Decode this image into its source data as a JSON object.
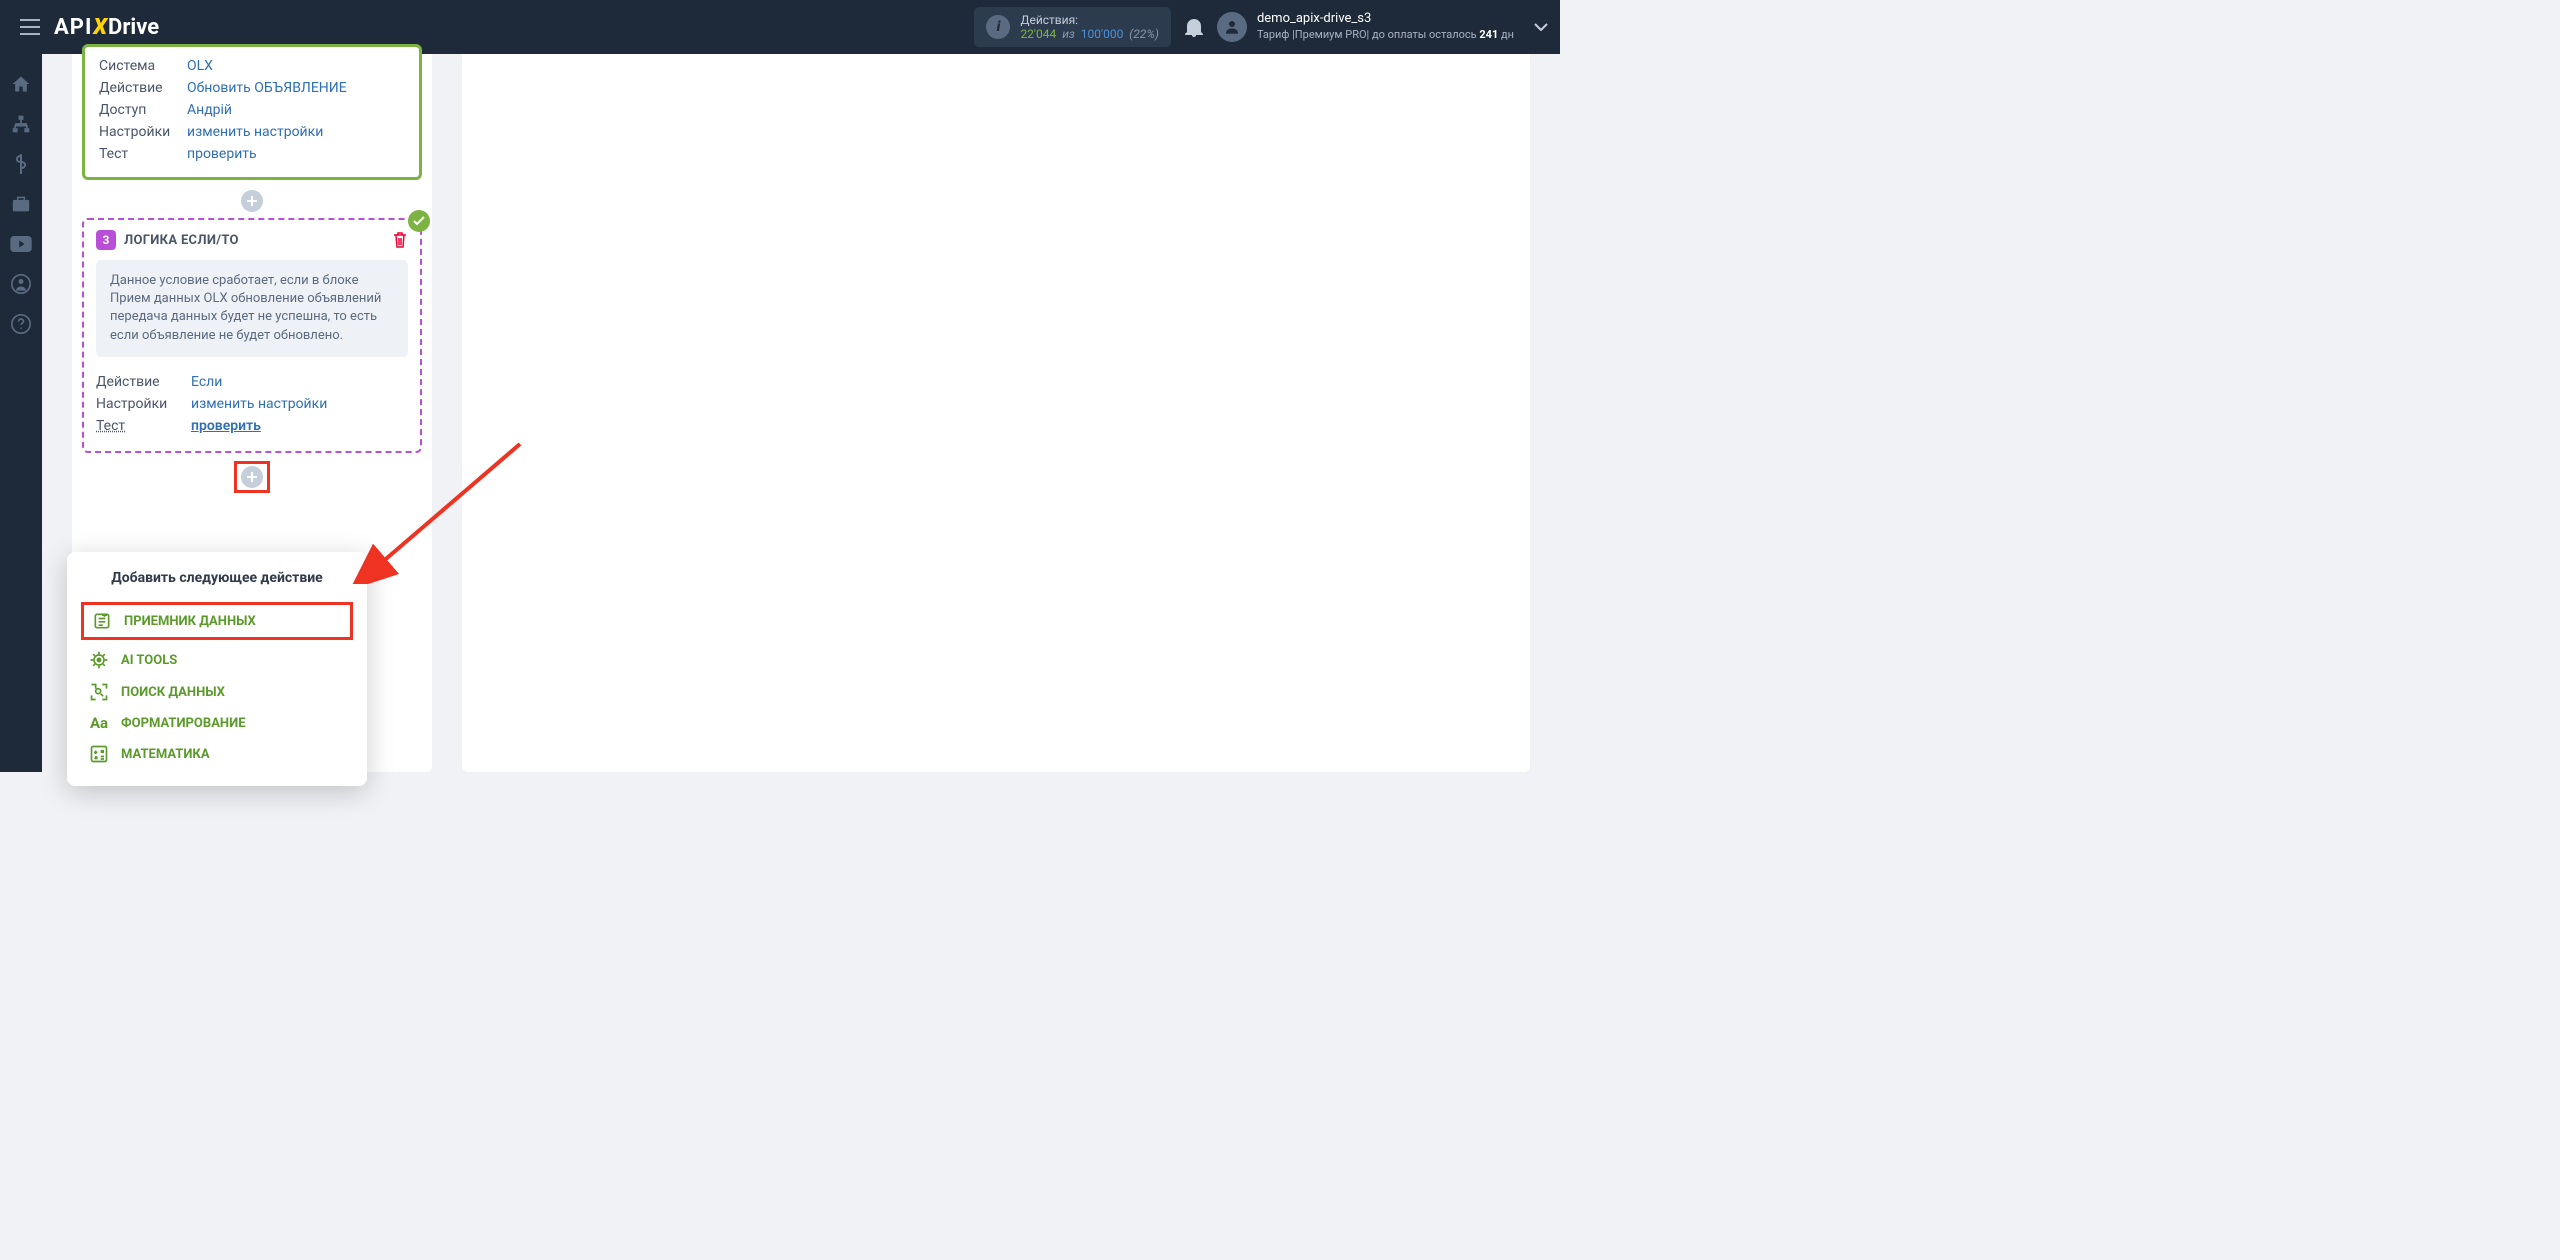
{
  "header": {
    "actions_label": "Действия:",
    "actions_current": "22'044",
    "actions_sep": "из",
    "actions_total": "100'000",
    "actions_pct": "(22%)",
    "user_name": "demo_apix-drive_s3",
    "user_plan_prefix": "Тариф |Премиум PRO| до оплаты осталось ",
    "user_plan_days": "241",
    "user_plan_suffix": " дн"
  },
  "block1": {
    "rows": [
      {
        "label": "Система",
        "value": "OLX"
      },
      {
        "label": "Действие",
        "value": "Обновить ОБЪЯВЛЕНИЕ"
      },
      {
        "label": "Доступ",
        "value": "Андрій"
      },
      {
        "label": "Настройки",
        "value": "изменить настройки"
      },
      {
        "label": "Тест",
        "value": "проверить"
      }
    ]
  },
  "block3": {
    "num": "3",
    "title": "ЛОГИКА ЕСЛИ/ТО",
    "desc": "Данное условие сработает, если в блоке Прием данных OLX обновление объявлений передача данных будет не успешна, то есть если объявление не будет обновлено.",
    "rows": [
      {
        "label": "Действие",
        "value": "Если"
      },
      {
        "label": "Настройки",
        "value": "изменить настройки"
      },
      {
        "label": "Тест",
        "value": "проверить"
      }
    ]
  },
  "popover": {
    "title": "Добавить следующее действие",
    "items": [
      "ПРИЕМНИК ДАННЫХ",
      "AI TOOLS",
      "ПОИСК ДАННЫХ",
      "ФОРМАТИРОВАНИЕ",
      "МАТЕМАТИКА"
    ]
  }
}
